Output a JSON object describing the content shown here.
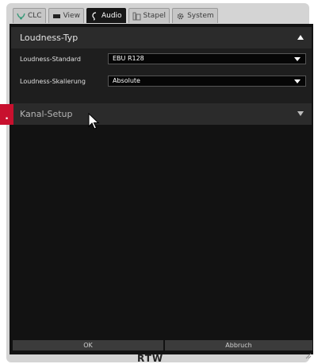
{
  "tabs": [
    {
      "label": "CLC",
      "icon": "clc-icon"
    },
    {
      "label": "View",
      "icon": "view-icon"
    },
    {
      "label": "Audio",
      "icon": "audio-icon"
    },
    {
      "label": "Stapel",
      "icon": "stack-icon"
    },
    {
      "label": "System",
      "icon": "gear-icon"
    }
  ],
  "active_tab": "Audio",
  "loudness_section": {
    "title": "Loudness-Typ",
    "standard_label": "Loudness-Standard",
    "standard_value": "EBU R128",
    "scaling_label": "Loudness-Skalierung",
    "scaling_value": "Absolute"
  },
  "channel_section": {
    "title": "Kanal-Setup"
  },
  "footer": {
    "ok_label": "OK",
    "cancel_label": "Abbruch",
    "logo_text": "RTW"
  },
  "marker_text": ".",
  "colors": {
    "panel": "#121212",
    "header": "#2b2b2b",
    "marker": "#c8102e"
  }
}
